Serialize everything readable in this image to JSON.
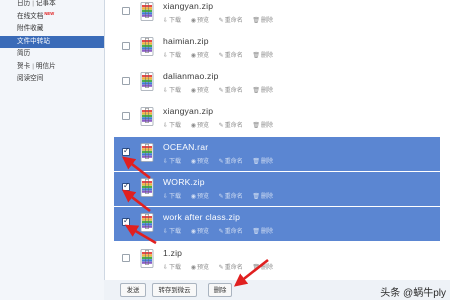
{
  "sidebar": {
    "items": [
      {
        "parts": [
          "日历",
          "记事本"
        ],
        "new": ""
      },
      {
        "parts": [
          "在线文档"
        ],
        "new": "NEW"
      },
      {
        "parts": [
          "附件收藏"
        ],
        "new": ""
      },
      {
        "parts": [
          "文件中转站"
        ],
        "new": "",
        "active": true
      },
      {
        "parts": [
          "简历"
        ],
        "new": ""
      },
      {
        "parts": [
          "贺卡",
          "明信片"
        ],
        "new": ""
      },
      {
        "parts": [
          "阅读空间"
        ],
        "new": ""
      }
    ]
  },
  "file_list": {
    "actions": {
      "download": "下载",
      "preview": "预览",
      "rename": "重命名",
      "delete": "删除"
    },
    "files": [
      {
        "name": "xiangyan.zip",
        "checked": false
      },
      {
        "name": "haimian.zip",
        "checked": false
      },
      {
        "name": "dalianmao.zip",
        "checked": false
      },
      {
        "name": "xiangyan.zip",
        "checked": false
      },
      {
        "name": "OCEAN.rar",
        "checked": true
      },
      {
        "name": "WORK.zip",
        "checked": true
      },
      {
        "name": "work after class.zip",
        "checked": true
      },
      {
        "name": "1.zip",
        "checked": false
      }
    ]
  },
  "toolbar": {
    "send": "发送",
    "save_to_cloud": "转存到微云",
    "delete": "删除"
  },
  "watermark": {
    "text": "头条 @蜗牛ply"
  },
  "colors": {
    "selected_row": "#5b86d2",
    "sidebar_active": "#3a6bb8",
    "arrow": "#e02020"
  }
}
